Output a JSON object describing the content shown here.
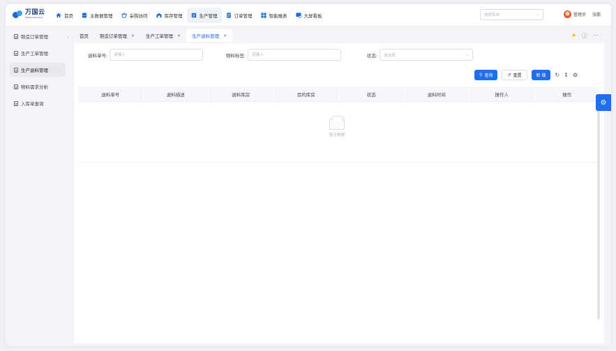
{
  "app": {
    "logo_cn": "万国云",
    "logo_en": "Intelicloud Cloud"
  },
  "nav": {
    "items": [
      {
        "label": "首页",
        "icon": "home-icon",
        "color": "#1e6bd6"
      },
      {
        "label": "主数据管理",
        "icon": "database-icon",
        "color": "#1e6bd6"
      },
      {
        "label": "采购协同",
        "icon": "basket-icon",
        "color": "#1e6bd6"
      },
      {
        "label": "库存管理",
        "icon": "warehouse-icon",
        "color": "#1e6bd6"
      },
      {
        "label": "生产管理",
        "icon": "production-icon",
        "color": "#1e6bd6"
      },
      {
        "label": "订单管理",
        "icon": "order-icon",
        "color": "#1e6bd6"
      },
      {
        "label": "智能报表",
        "icon": "report-icon",
        "color": "#1e6bd6"
      },
      {
        "label": "大屏看板",
        "icon": "dashboard-icon",
        "color": "#1e6bd6"
      }
    ],
    "active_index": 4,
    "search_placeholder": "搜索菜单"
  },
  "user": {
    "role": "管理员",
    "name": "张鹏"
  },
  "sidebar": {
    "items": [
      {
        "label": "制造订单管理"
      },
      {
        "label": "生产工单管理"
      },
      {
        "label": "生产退料管理"
      },
      {
        "label": "物料需求分析"
      },
      {
        "label": "入库单查询"
      }
    ],
    "active_index": 2
  },
  "tabs": {
    "items": [
      {
        "label": "首页",
        "closable": false
      },
      {
        "label": "制造订单管理",
        "closable": true
      },
      {
        "label": "生产工单管理",
        "closable": true
      },
      {
        "label": "生产退料管理",
        "closable": true
      }
    ],
    "active_index": 3,
    "close_glyph": "×"
  },
  "filters": {
    "return_no_label": "退料单号:",
    "return_no_placeholder": "请输入",
    "material_label": "物料标签:",
    "material_placeholder": "请输入",
    "status_label": "状态:",
    "status_placeholder": "请选择"
  },
  "buttons": {
    "query": "查询",
    "reset": "重置",
    "add": "新 增"
  },
  "table": {
    "columns": [
      "退料单号",
      "退料描述",
      "退料库房",
      "目的库房",
      "状态",
      "退料时间",
      "操作人",
      "操作"
    ],
    "rows": [],
    "empty_text": "暂无数据"
  },
  "theme": {
    "primary": "#1e6ff0",
    "favorite": "#f5b400"
  }
}
